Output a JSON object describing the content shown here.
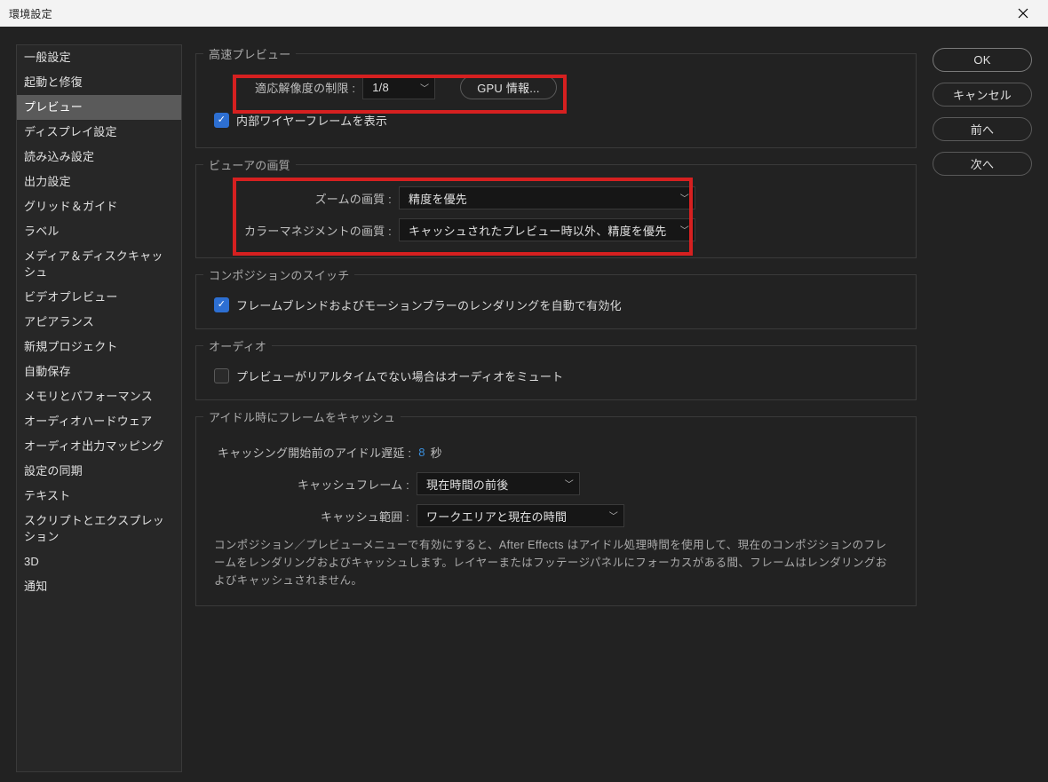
{
  "window": {
    "title": "環境設定"
  },
  "buttons": {
    "ok": "OK",
    "cancel": "キャンセル",
    "prev": "前へ",
    "next": "次へ"
  },
  "sidebar": {
    "items": [
      "一般設定",
      "起動と修復",
      "プレビュー",
      "ディスプレイ設定",
      "読み込み設定",
      "出力設定",
      "グリッド＆ガイド",
      "ラベル",
      "メディア＆ディスクキャッシュ",
      "ビデオプレビュー",
      "アピアランス",
      "新規プロジェクト",
      "自動保存",
      "メモリとパフォーマンス",
      "オーディオハードウェア",
      "オーディオ出力マッピング",
      "設定の同期",
      "テキスト",
      "スクリプトとエクスプレッション",
      "3D",
      "通知"
    ],
    "selected_index": 2
  },
  "fast_preview": {
    "title": "高速プレビュー",
    "adaptive_label": "適応解像度の制限 :",
    "adaptive_value": "1/8",
    "gpu_button": "GPU 情報...",
    "wireframe_label": "内部ワイヤーフレームを表示"
  },
  "viewer_quality": {
    "title": "ビューアの画質",
    "zoom_label": "ズームの画質 :",
    "zoom_value": "精度を優先",
    "color_label": "カラーマネジメントの画質 :",
    "color_value": "キャッシュされたプレビュー時以外、精度を優先"
  },
  "comp_switches": {
    "title": "コンポジションのスイッチ",
    "auto_label": "フレームブレンドおよびモーションブラーのレンダリングを自動で有効化"
  },
  "audio": {
    "title": "オーディオ",
    "mute_label": "プレビューがリアルタイムでない場合はオーディオをミュート"
  },
  "idle_cache": {
    "title": "アイドル時にフレームをキャッシュ",
    "delay_label_pre": "キャッシング開始前のアイドル遅延 :",
    "delay_value": "8",
    "delay_unit": "秒",
    "cache_frames_label": "キャッシュフレーム :",
    "cache_frames_value": "現在時間の前後",
    "cache_range_label": "キャッシュ範囲 :",
    "cache_range_value": "ワークエリアと現在の時間",
    "description": "コンポジション／プレビューメニューで有効にすると、After Effects はアイドル処理時間を使用して、現在のコンポジションのフレームをレンダリングおよびキャッシュします。レイヤーまたはフッテージパネルにフォーカスがある間、フレームはレンダリングおよびキャッシュされません。"
  }
}
